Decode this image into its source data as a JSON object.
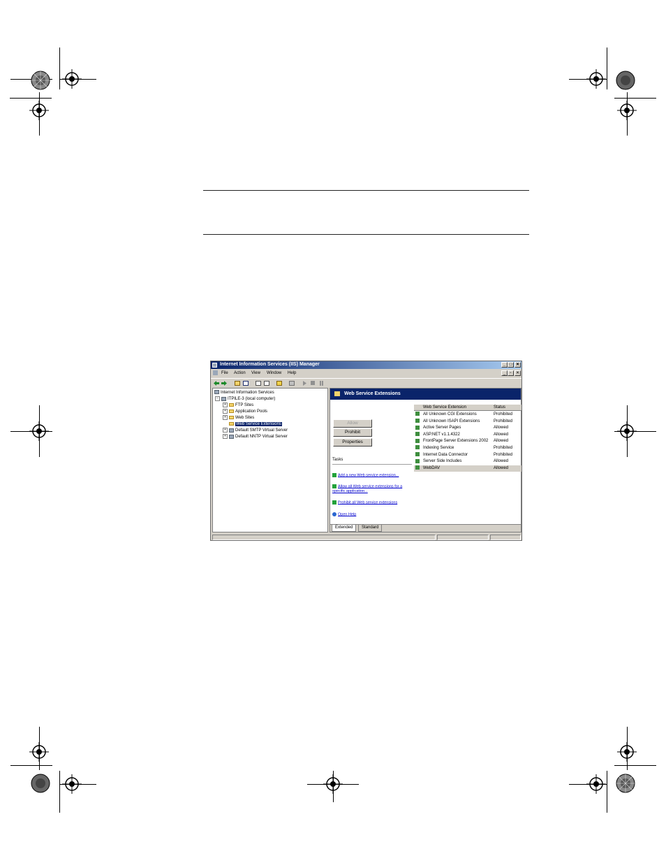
{
  "window": {
    "title": "Internet Information Services (IIS) Manager",
    "controls": [
      "_",
      "□",
      "✕"
    ],
    "inner_controls": [
      "_",
      "▫",
      "✕"
    ]
  },
  "menu": [
    "File",
    "Action",
    "View",
    "Window",
    "Help"
  ],
  "tree": {
    "root": "Internet Information Services",
    "computer": "ITPILE-3 (local computer)",
    "expand_plus": "+",
    "expand_minus": "−",
    "items": [
      "FTP Sites",
      "Application Pools",
      "Web Sites",
      "Web Service Extensions",
      "Default SMTP Virtual Server",
      "Default NNTP Virtual Server"
    ]
  },
  "panel": {
    "title": "Web Service Extensions",
    "buttons": {
      "allow": "Allow",
      "prohibit": "Prohibit",
      "properties": "Properties"
    },
    "tasks_label": "Tasks",
    "links": [
      "Add a new Web service extension...",
      "Allow all Web service extensions for a",
      "specific application...",
      "Prohibit all Web service extensions",
      "Open Help"
    ]
  },
  "list": {
    "columns": [
      "Web Service Extension",
      "Status"
    ],
    "rows": [
      {
        "name": "All Unknown CGI Extensions",
        "status": "Prohibited"
      },
      {
        "name": "All Unknown ISAPI Extensions",
        "status": "Prohibited"
      },
      {
        "name": "Active Server Pages",
        "status": "Allowed"
      },
      {
        "name": "ASP.NET v1.1.4322",
        "status": "Allowed"
      },
      {
        "name": "FrontPage Server Extensions 2002",
        "status": "Allowed"
      },
      {
        "name": "Indexing Service",
        "status": "Prohibited"
      },
      {
        "name": "Internet Data Connector",
        "status": "Prohibited"
      },
      {
        "name": "Server Side Includes",
        "status": "Allowed"
      },
      {
        "name": "WebDAV",
        "status": "Allowed"
      }
    ]
  },
  "tabs": [
    "Extended",
    "Standard"
  ]
}
